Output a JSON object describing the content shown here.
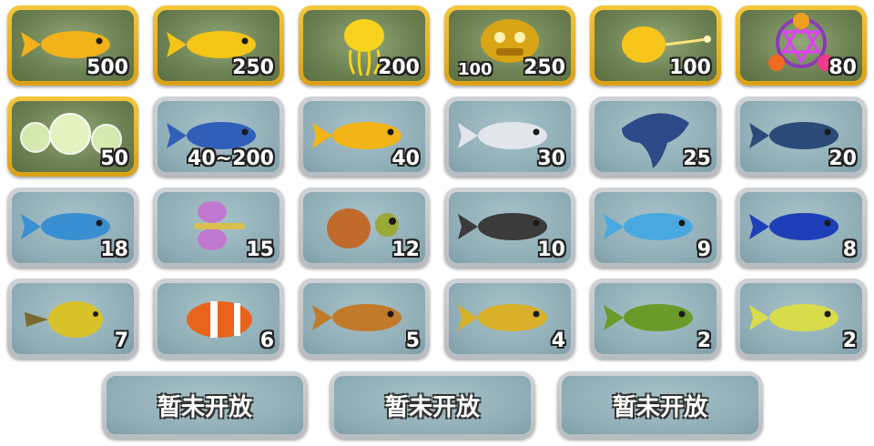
{
  "rows": [
    [
      {
        "id": "golden-shrimp",
        "value": "500",
        "gold": true,
        "icon": "golden-shrimp-icon",
        "color": "#f2b21a"
      },
      {
        "id": "golden-turtle",
        "value": "250",
        "gold": true,
        "icon": "golden-turtle-icon",
        "color": "#f5c518"
      },
      {
        "id": "golden-jellyfish",
        "value": "200",
        "gold": true,
        "icon": "golden-jellyfish-icon",
        "color": "#f7d21e"
      },
      {
        "id": "golden-totem",
        "value": "250",
        "value_left": "100",
        "gold": true,
        "icon": "golden-totem-icon",
        "color": "#d9a514"
      },
      {
        "id": "golden-ray",
        "value": "100",
        "gold": true,
        "icon": "golden-ray-icon",
        "color": "#f7c51c"
      },
      {
        "id": "magic-wheel",
        "value": "80",
        "gold": true,
        "icon": "magic-wheel-icon",
        "color": "#c23bd0"
      }
    ],
    [
      {
        "id": "bubble-orbs",
        "value": "50",
        "gold": true,
        "icon": "bubble-orbs-icon",
        "color": "#d8f0b0"
      },
      {
        "id": "dolphin",
        "value": "40~200",
        "gold": false,
        "icon": "dolphin-icon",
        "color": "#2f5fb8"
      },
      {
        "id": "golden-hammerhead",
        "value": "40",
        "gold": false,
        "icon": "golden-hammerhead-icon",
        "color": "#f2b416"
      },
      {
        "id": "silver-sawfish",
        "value": "30",
        "gold": false,
        "icon": "silver-sawfish-icon",
        "color": "#e2e6ea"
      },
      {
        "id": "manta-ray",
        "value": "25",
        "gold": false,
        "icon": "manta-ray-icon",
        "color": "#2d4a88"
      },
      {
        "id": "swordfish",
        "value": "20",
        "gold": false,
        "icon": "swordfish-icon",
        "color": "#2c4a78"
      }
    ],
    [
      {
        "id": "blue-lanternfish",
        "value": "18",
        "gold": false,
        "icon": "lanternfish-icon",
        "color": "#3a8fd0"
      },
      {
        "id": "butterflyfish",
        "value": "15",
        "gold": false,
        "icon": "butterflyfish-icon",
        "color": "#c078d0"
      },
      {
        "id": "sea-turtle",
        "value": "12",
        "gold": false,
        "icon": "sea-turtle-icon",
        "color": "#c06a2c"
      },
      {
        "id": "moorish-idol",
        "value": "10",
        "gold": false,
        "icon": "moorish-idol-icon",
        "color": "#3b3b3b"
      },
      {
        "id": "lantern-anglerfish",
        "value": "9",
        "gold": false,
        "icon": "anglerfish-icon",
        "color": "#4aa8e0"
      },
      {
        "id": "blue-tang",
        "value": "8",
        "gold": false,
        "icon": "blue-tang-icon",
        "color": "#1f3fb8"
      }
    ],
    [
      {
        "id": "pufferfish",
        "value": "7",
        "gold": false,
        "icon": "pufferfish-icon",
        "color": "#d8c22a"
      },
      {
        "id": "clownfish",
        "value": "6",
        "gold": false,
        "icon": "clownfish-icon",
        "color": "#e8641c"
      },
      {
        "id": "striped-fish",
        "value": "5",
        "gold": false,
        "icon": "striped-fish-icon",
        "color": "#c07a2a"
      },
      {
        "id": "bee-fish",
        "value": "4",
        "gold": false,
        "icon": "bee-fish-icon",
        "color": "#d8b02a"
      },
      {
        "id": "green-fish",
        "value": "2",
        "gold": false,
        "icon": "green-fish-icon",
        "color": "#6a9a28"
      },
      {
        "id": "spotted-fish",
        "value": "2",
        "gold": false,
        "icon": "spotted-fish-icon",
        "color": "#d8dc4a"
      }
    ]
  ],
  "buttons": [
    {
      "label": "暂未开放"
    },
    {
      "label": "暂未开放"
    },
    {
      "label": "暂未开放"
    }
  ]
}
